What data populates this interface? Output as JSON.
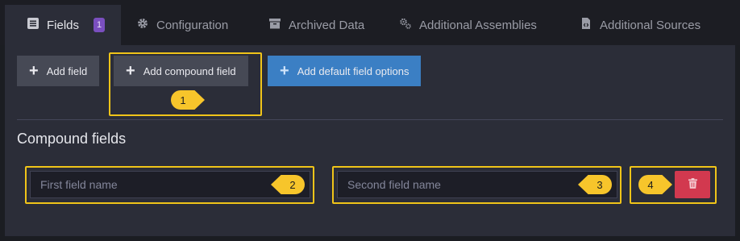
{
  "tabs": [
    {
      "label": "Fields",
      "icon": "list-icon",
      "badge": "1"
    },
    {
      "label": "Configuration",
      "icon": "gear-icon"
    },
    {
      "label": "Archived Data",
      "icon": "archive-icon"
    },
    {
      "label": "Additional Assemblies",
      "icon": "gears-icon"
    },
    {
      "label": "Additional Sources",
      "icon": "file-code-icon"
    }
  ],
  "toolbar": {
    "add_field": "Add field",
    "add_compound_field": "Add compound field",
    "add_default_field_options": "Add default field options"
  },
  "compound": {
    "title": "Compound fields",
    "first_placeholder": "First field name",
    "second_placeholder": "Second field name"
  },
  "markers": [
    "1",
    "2",
    "3",
    "4"
  ],
  "colors": {
    "accent_yellow": "#f0c419",
    "primary_blue": "#3b7fc4",
    "danger_red": "#d2394f",
    "badge_purple": "#7a4fbf"
  }
}
